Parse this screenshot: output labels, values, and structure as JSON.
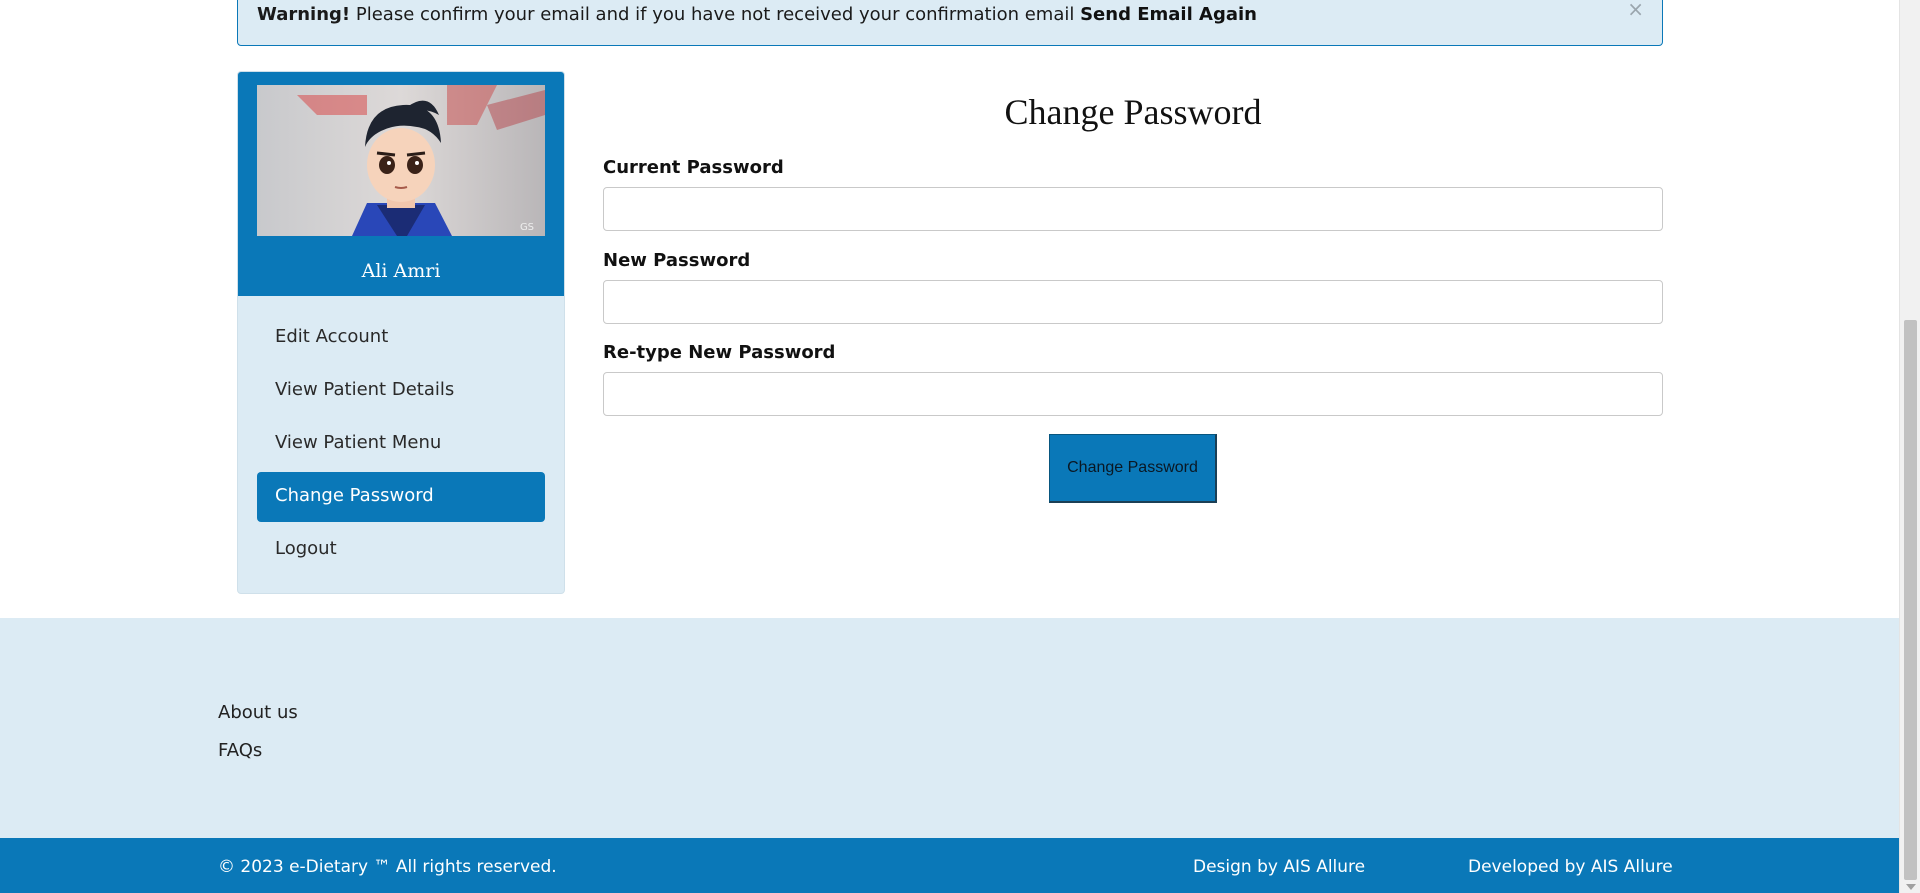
{
  "alert": {
    "strong": "Warning!",
    "message": "Please confirm your email and if you have not received your confirmation email",
    "link": "Send Email Again",
    "close": "×"
  },
  "profile": {
    "name": "Ali Amri",
    "avatar_watermark": "GS"
  },
  "sidebar": {
    "items": [
      {
        "label": "Edit Account"
      },
      {
        "label": "View Patient Details"
      },
      {
        "label": "View Patient Menu"
      },
      {
        "label": "Change Password",
        "active": true
      },
      {
        "label": "Logout"
      }
    ]
  },
  "form": {
    "title": "Change Password",
    "current_label": "Current Password",
    "current_value": "",
    "new_label": "New Password",
    "new_value": "",
    "retype_label": "Re-type New Password",
    "retype_value": "",
    "submit_label": "Change Password"
  },
  "footer": {
    "links": [
      "About us",
      "FAQs"
    ],
    "copyright": "© 2023 e-Dietary ™ All rights reserved.",
    "design": "Design by AIS Allure",
    "developed": "Developed by AIS Allure"
  },
  "colors": {
    "primary": "#0a78b8",
    "light_bg": "#dcebf4"
  }
}
